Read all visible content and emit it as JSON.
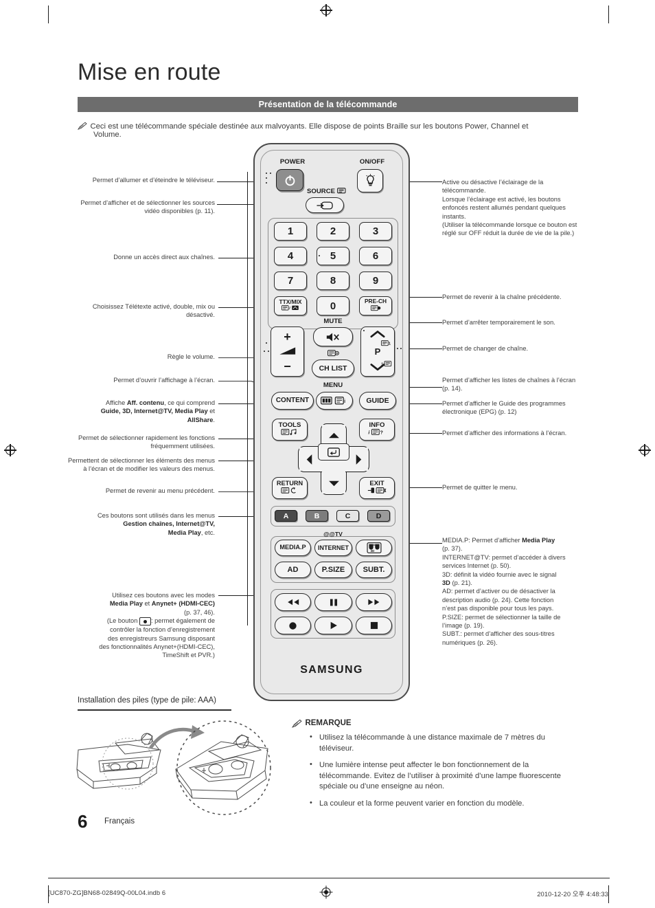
{
  "header": {
    "title": "Mise en route",
    "section_bar": "Présentation de la télécommande",
    "note": "Ceci est une télécommande spéciale destinée aux malvoyants. Elle dispose de points Braille sur les boutons Power, Channel et",
    "note_line2": "Volume."
  },
  "callouts_left": [
    {
      "id": "power",
      "text": "Permet d’allumer et d’éteindre le téléviseur."
    },
    {
      "id": "source",
      "text": "Permet d’afficher et de sélectionner les sources vidéo disponibles (p. 11)."
    },
    {
      "id": "numbers",
      "text": "Donne un accès direct aux chaînes."
    },
    {
      "id": "ttxmix",
      "text": "Choisissez Télétexte activé, double, mix ou désactivé."
    },
    {
      "id": "volume",
      "text": "Règle le volume."
    },
    {
      "id": "menu",
      "text": "Permet d’ouvrir l’affichage à l’écran."
    },
    {
      "id": "content_a",
      "text": "Affiche "
    },
    {
      "id": "content_b",
      "text": "Aff. contenu"
    },
    {
      "id": "content_c",
      "text": ", ce qui comprend"
    },
    {
      "id": "content_d",
      "text": "Guide, 3D, Internet@TV, Media Play"
    },
    {
      "id": "content_e",
      "text": " et"
    },
    {
      "id": "content_f",
      "text": "AllShare"
    },
    {
      "id": "content_g",
      "text": "."
    },
    {
      "id": "tools",
      "text": "Permet de sélectionner rapidement les fonctions fréquemment utilisées."
    },
    {
      "id": "arrows",
      "text": "Permettent de sélectionner les éléments des menus à l’écran et de modifier les valeurs des menus."
    },
    {
      "id": "return",
      "text": "Permet de revenir au menu précédent."
    },
    {
      "id": "color_a",
      "text": "Ces boutons sont utilisés dans les menus"
    },
    {
      "id": "color_b",
      "text": "Gestion chaînes, Internet@TV,"
    },
    {
      "id": "color_c",
      "text": "Media Play"
    },
    {
      "id": "color_d",
      "text": ", etc."
    },
    {
      "id": "media_a",
      "text": "Utilisez ces boutons avec les modes"
    },
    {
      "id": "media_b",
      "text": "Media Play"
    },
    {
      "id": "media_c",
      "text": " et "
    },
    {
      "id": "media_d",
      "text": "Anynet+ (HDMI-CEC)"
    },
    {
      "id": "media_e",
      "text": "(p. 37, 46)."
    },
    {
      "id": "media_f",
      "text": "(Le bouton"
    },
    {
      "id": "media_g",
      "text": ": permet également de"
    },
    {
      "id": "media_h",
      "text": "contrôler la fonction d’enregistrement"
    },
    {
      "id": "media_i",
      "text": "des enregistreurs Samsung disposant"
    },
    {
      "id": "media_j",
      "text": "des fonctionnalités Anynet+(HDMI-CEC),"
    },
    {
      "id": "media_k",
      "text": "TimeShift et PVR.)"
    }
  ],
  "callouts_right": {
    "onoff": "Active ou désactive l’éclairage de la télécommande.\nLorsque l’éclairage est activé, les boutons enfoncés restent allumés pendant quelques instants.\n(Utiliser la télécommande lorsque ce bouton est réglé sur OFF réduit la durée de vie de la pile.)",
    "prech": "Permet de revenir à la chaîne précédente.",
    "mute": "Permet d’arrêter temporairement le son.",
    "channel": "Permet de changer de chaîne.",
    "chlist": "Permet d’afficher les listes de chaînes à l’écran (p. 14).",
    "guide": "Permet d’afficher le Guide des programmes électronique (EPG) (p. 12)",
    "info": " Permet d’afficher des informations à l’écran.",
    "exit": "Permet de quitter le menu.",
    "media_lines": [
      {
        "key": "MEDIA.P: Permet d’afficher ",
        "bold": "Media Play",
        "rest": ""
      },
      {
        "plain": "(p. 37)."
      },
      {
        "plain": "INTERNET@TV: permet d’accéder à divers"
      },
      {
        "plain": "services Internet (p. 50)."
      },
      {
        "plain": "3D: définit la vidéo fournie avec le signal"
      },
      {
        "key": "",
        "bold": "3D",
        "rest": " (p. 21)."
      },
      {
        "plain": "AD: permet d’activer ou de désactiver la"
      },
      {
        "plain": "description audio (p. 24). Cette fonction"
      },
      {
        "plain": "n’est pas disponible pour tous les pays."
      },
      {
        "plain": "P.SIZE: permet de sélectionner la taille de"
      },
      {
        "plain": "l’image (p. 19)."
      },
      {
        "plain": "SUBT.: permet d’afficher des sous-titres"
      },
      {
        "plain": "numériques (p. 26)."
      }
    ]
  },
  "remote": {
    "power_label": "POWER",
    "onoff_label": "ON/OFF",
    "source_label": "SOURCE",
    "keys": [
      "1",
      "2",
      "3",
      "4",
      "5",
      "6",
      "7",
      "8",
      "9"
    ],
    "zero": "0",
    "ttxmix": "TTX/MIX",
    "prech": "PRE-CH",
    "mute_label": "MUTE",
    "vol_plus": "+",
    "vol_minus": "−",
    "chlist": "CH LIST",
    "p_label": "P",
    "menu_label": "MENU",
    "content": "CONTENT",
    "guide": "GUIDE",
    "tools": "TOOLS",
    "info": "INFO",
    "return": "RETURN",
    "exit": "EXIT",
    "color_buttons": [
      {
        "label": "A",
        "color": "#4a4a4a",
        "text_color": "#ffffff"
      },
      {
        "label": "B",
        "color": "#7d7d7d",
        "text_color": "#ffffff"
      },
      {
        "label": "C",
        "color": "#e6e6e6",
        "text_color": "#1c1c1c"
      },
      {
        "label": "D",
        "color": "#9a9a9a",
        "text_color": "#1c1c1c"
      }
    ],
    "attv_label": "@TV",
    "media_p": "MEDIA.P",
    "internet": "INTERNET",
    "three_d": "3D-icon",
    "ad": "AD",
    "psize": "P.SIZE",
    "subt": "SUBT.",
    "brand": "SAMSUNG"
  },
  "battery": {
    "title": "Installation des piles (type de pile: AAA)"
  },
  "remarque": {
    "head": "REMARQUE",
    "items": [
      "Utilisez la télécommande à une distance maximale de 7 mètres du téléviseur.",
      "Une lumière intense peut affecter le bon fonctionnement de la télécommande. Evitez de l’utiliser à proximité d’une lampe fluorescente spéciale ou d’une enseigne au néon.",
      "La couleur et la forme peuvent varier en fonction du modèle."
    ]
  },
  "footer": {
    "page_number": "6",
    "language": "Français",
    "left": "[UC870-ZG]BN68-02849Q-00L04.indb   6",
    "right": "2010-12-20   오후 4:48:33"
  }
}
